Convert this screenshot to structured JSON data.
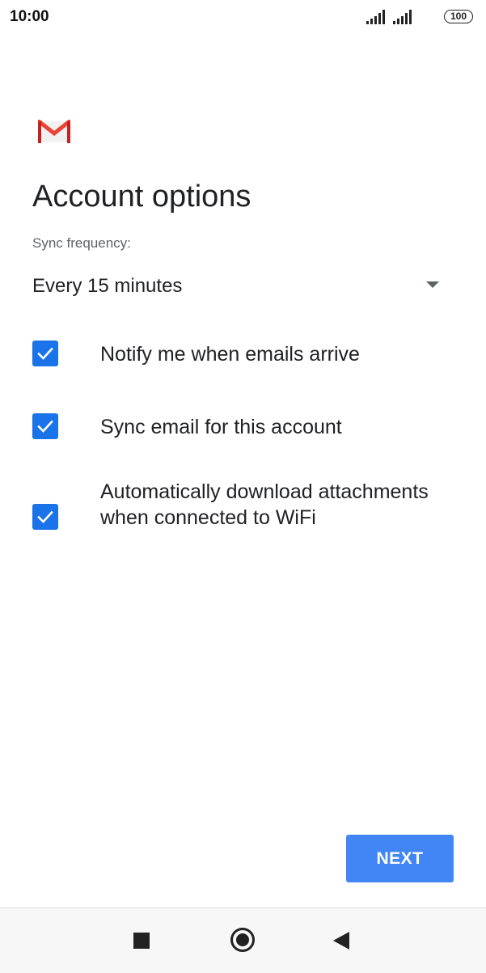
{
  "status_bar": {
    "time": "10:00",
    "battery": "100",
    "icons": [
      "signal-icon",
      "signal-icon",
      "battery-icon"
    ]
  },
  "app": {
    "logo_icon": "gmail-icon",
    "brand_colors": {
      "red": "#EA4335",
      "gmail_dark_red": "#C5221F",
      "envelope": "#F1F1F1"
    }
  },
  "page": {
    "title": "Account options"
  },
  "sync": {
    "label": "Sync frequency:",
    "selected": "Every 15 minutes",
    "icon": "dropdown-arrow-icon"
  },
  "options": [
    {
      "label": "Notify me when emails arrive",
      "checked": true
    },
    {
      "label": "Sync email for this account",
      "checked": true
    },
    {
      "label": "Automatically download attachments when connected to WiFi",
      "checked": true
    }
  ],
  "actions": {
    "next_label": "NEXT",
    "accent": "#4285F4"
  },
  "nav_bar": {
    "icons": [
      "recents-icon",
      "home-icon",
      "back-icon"
    ]
  }
}
